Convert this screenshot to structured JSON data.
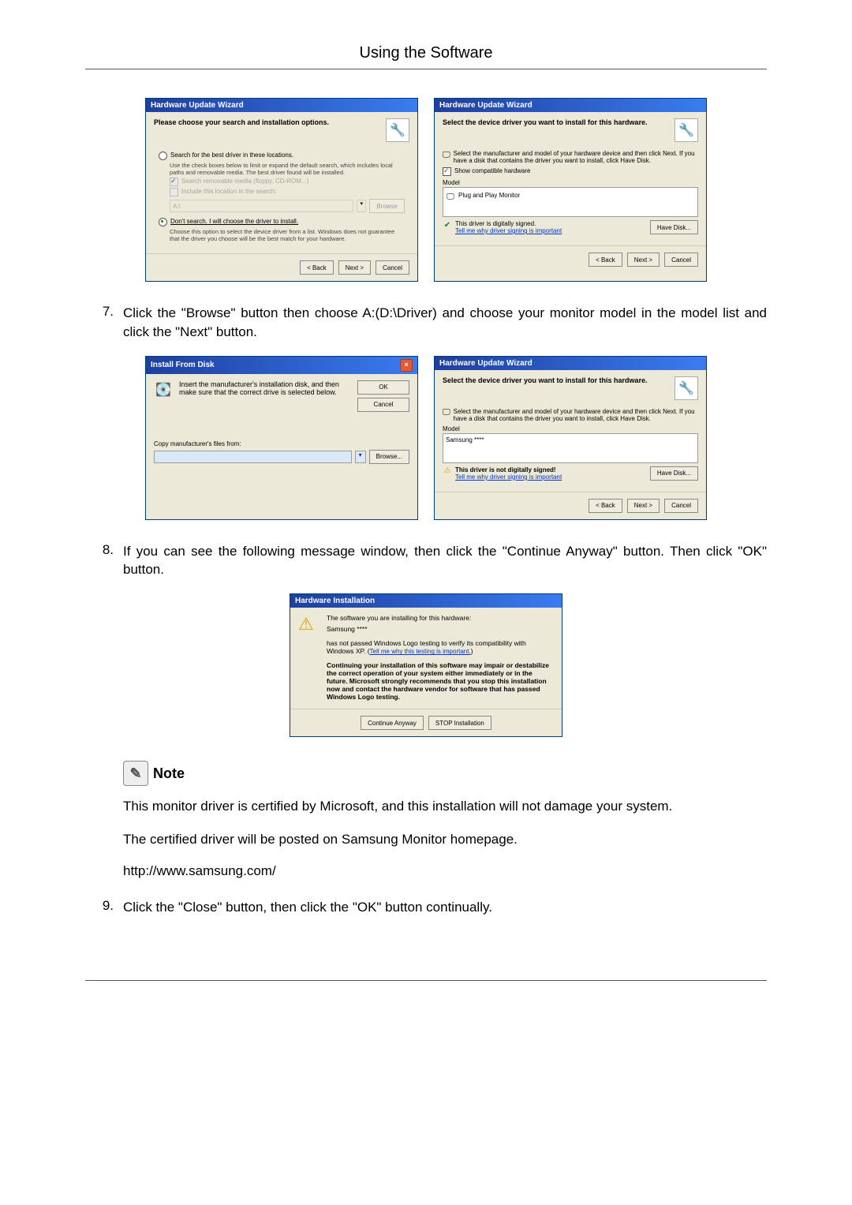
{
  "page": {
    "header": "Using the Software"
  },
  "dlg_search": {
    "title": "Hardware Update Wizard",
    "heading": "Please choose your search and installation options.",
    "radio1": "Search for the best driver in these locations.",
    "radio1_sub": "Use the check boxes below to limit or expand the default search, which includes local paths and removable media. The best driver found will be installed.",
    "chk1": "Search removable media (floppy, CD-ROM...)",
    "chk2": "Include this location in the search:",
    "input_path": "A:\\",
    "browse": "Browse",
    "radio2": "Don't search. I will choose the driver to install.",
    "radio2_sub": "Choose this option to select the device driver from a list. Windows does not guarantee that the driver you choose will be the best match for your hardware.",
    "back": "< Back",
    "next": "Next >",
    "cancel": "Cancel"
  },
  "dlg_select": {
    "title": "Hardware Update Wizard",
    "heading": "Select the device driver you want to install for this hardware.",
    "sub": "Select the manufacturer and model of your hardware device and then click Next. If you have a disk that contains the driver you want to install, click Have Disk.",
    "show_compat": "Show compatible hardware",
    "model_label": "Model",
    "model_item": "Plug and Play Monitor",
    "signed": "This driver is digitally signed.",
    "tell_me": "Tell me why driver signing is important",
    "have_disk": "Have Disk...",
    "back": "< Back",
    "next": "Next >",
    "cancel": "Cancel"
  },
  "step7": {
    "num": "7.",
    "text": "Click the \"Browse\" button then choose A:(D:\\Driver) and choose your monitor model in the model list and click the \"Next\" button."
  },
  "dlg_disk": {
    "title": "Install From Disk",
    "msg": "Insert the manufacturer's installation disk, and then make sure that the correct drive is selected below.",
    "ok": "OK",
    "cancel": "Cancel",
    "copy_from": "Copy manufacturer's files from:",
    "browse": "Browse..."
  },
  "dlg_select2": {
    "title": "Hardware Update Wizard",
    "heading": "Select the device driver you want to install for this hardware.",
    "sub": "Select the manufacturer and model of your hardware device and then click Next. If you have a disk that contains the driver you want to install, click Have Disk.",
    "model_label": "Model",
    "model_item": "Samsung ****",
    "not_signed": "This driver is not digitally signed!",
    "tell_me": "Tell me why driver signing is important",
    "have_disk": "Have Disk...",
    "back": "< Back",
    "next": "Next >",
    "cancel": "Cancel"
  },
  "step8": {
    "num": "8.",
    "text": "If you can see the following message window, then click the \"Continue Anyway\" button. Then click \"OK\" button."
  },
  "dlg_hwinstall": {
    "title": "Hardware Installation",
    "line1": "The software you are installing for this hardware:",
    "line2": "Samsung ****",
    "line3a": "has not passed Windows Logo testing to verify its compatibility with Windows XP. (",
    "line3link": "Tell me why this testing is important.",
    "line3b": ")",
    "bold": "Continuing your installation of this software may impair or destabilize the correct operation of your system either immediately or in the future. Microsoft strongly recommends that you stop this installation now and contact the hardware vendor for software that has passed Windows Logo testing.",
    "continue": "Continue Anyway",
    "stop": "STOP Installation"
  },
  "note": {
    "label": "Note",
    "p1": "This monitor driver is certified by Microsoft, and this installation will not damage your system.",
    "p2": "The certified driver will be posted on Samsung Monitor homepage.",
    "url": "http://www.samsung.com/"
  },
  "step9": {
    "num": "9.",
    "text": "Click the \"Close\" button, then click the \"OK\" button continually."
  }
}
